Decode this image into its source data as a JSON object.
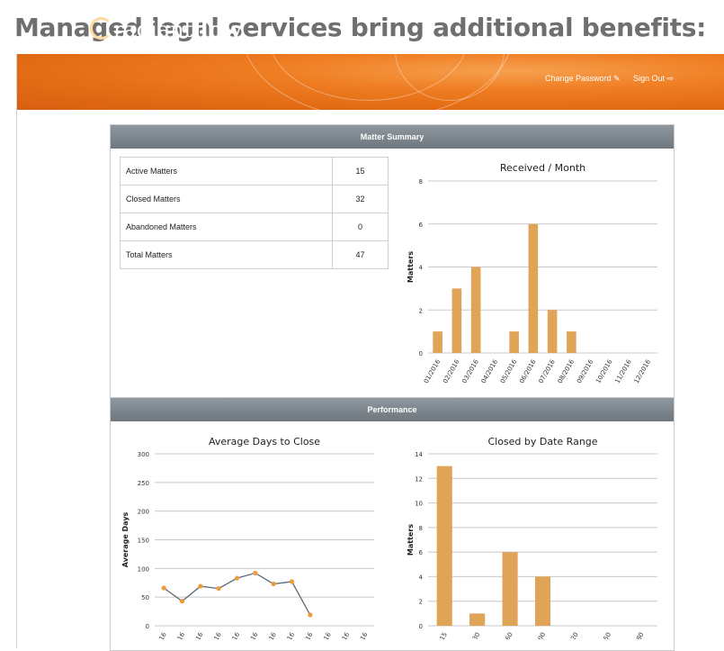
{
  "headline": "Managed legal services bring additional benefits:",
  "brand": {
    "logo_left": "radiant",
    "logo_right": "flow"
  },
  "header": {
    "change_password": "Change Password ✎",
    "sign_out": "Sign Out ⇨"
  },
  "panels": {
    "summary_title": "Matter Summary",
    "performance_title": "Performance"
  },
  "summary_table": {
    "rows": [
      {
        "label": "Active Matters",
        "value": "15"
      },
      {
        "label": "Closed Matters",
        "value": "32"
      },
      {
        "label": "Abandoned Matters",
        "value": "0"
      },
      {
        "label": "Total Matters",
        "value": "47"
      }
    ]
  },
  "colors": {
    "bar": "#e0a458",
    "line": "#5b6a78",
    "point": "#ef9a3a",
    "header_orange": "#ef7d22"
  },
  "chart_data": [
    {
      "type": "bar",
      "title": "Received / Month",
      "ylabel": "Matters",
      "xlabel": "",
      "categories": [
        "01/2016",
        "02/2016",
        "03/2016",
        "04/2016",
        "05/2016",
        "06/2016",
        "07/2016",
        "08/2016",
        "09/2016",
        "10/2016",
        "11/2016",
        "12/2016"
      ],
      "values": [
        1,
        3,
        4,
        0,
        1,
        6,
        2,
        1,
        0,
        0,
        0,
        0
      ],
      "ylim": [
        0,
        8
      ],
      "yticks": [
        0,
        2,
        4,
        6,
        8
      ],
      "grid": true
    },
    {
      "type": "line",
      "title": "Average Days to Close",
      "ylabel": "Average Days",
      "xlabel": "",
      "categories": [
        "…016",
        "…016",
        "…016",
        "…016",
        "…016",
        "…016",
        "…016",
        "…016",
        "…016",
        "…016",
        "…016",
        "…016"
      ],
      "values": [
        66,
        43,
        69,
        65,
        83,
        92,
        73,
        77,
        19,
        null,
        null,
        null
      ],
      "ylim": [
        0,
        300
      ],
      "yticks": [
        0,
        50,
        100,
        150,
        200,
        250,
        300
      ],
      "grid": true
    },
    {
      "type": "bar",
      "title": "Closed by Date Range",
      "ylabel": "Matters",
      "xlabel": "",
      "categories": [
        "…-15",
        "…-30",
        "…-60",
        "…100",
        "…120",
        "…150",
        "…180"
      ],
      "values": [
        13,
        1,
        6,
        4,
        0,
        0,
        0
      ],
      "ylim": [
        0,
        14
      ],
      "yticks": [
        0,
        2,
        4,
        6,
        8,
        10,
        12,
        14
      ],
      "grid": true
    }
  ]
}
